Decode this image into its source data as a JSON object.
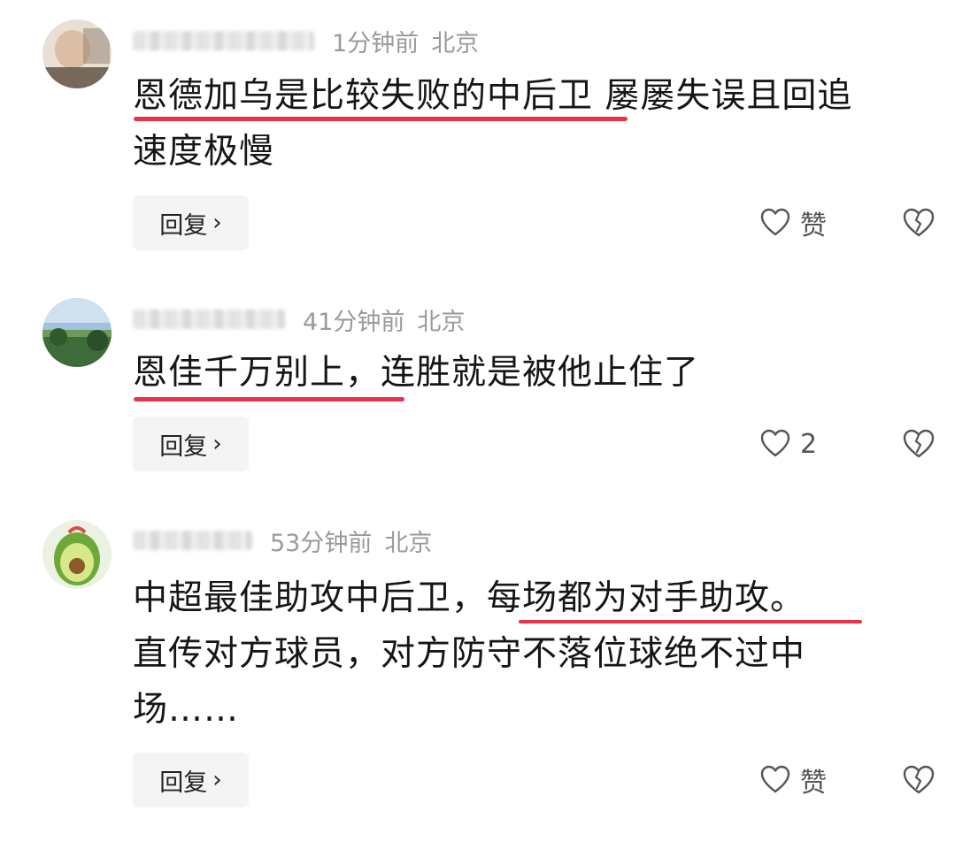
{
  "comments": [
    {
      "time": "1分钟前",
      "location": "北京",
      "text_lines": [
        "恩德加乌是比较失败的中后卫 屡屡失误且回追",
        "速度极慢"
      ],
      "reply_label": "回复",
      "like_label": "赞"
    },
    {
      "time": "41分钟前",
      "location": "北京",
      "text_lines": [
        "恩佳千万别上，连胜就是被他止住了"
      ],
      "reply_label": "回复",
      "like_label": "2"
    },
    {
      "time": "53分钟前",
      "location": "北京",
      "text_lines": [
        "中超最佳助攻中后卫，每场都为对手助攻。",
        "直传对方球员，对方防守不落位球绝不过中",
        "场……"
      ],
      "reply_label": "回复",
      "like_label": "赞"
    }
  ],
  "icons": {
    "reply_chevron": "chevron-right-icon",
    "like": "heart-outline-icon",
    "dislike": "broken-heart-icon"
  },
  "colors": {
    "underline": "#e8334a",
    "meta_text": "#9a9a9a",
    "reply_bg": "#f4f4f4"
  }
}
